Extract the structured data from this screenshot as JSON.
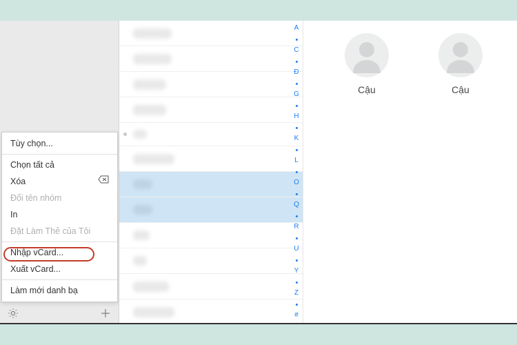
{
  "sidebar": {
    "menu": {
      "preferences": "Tùy chọn...",
      "select_all": "Chọn tất cả",
      "delete": "Xóa",
      "rename_group": "Đổi tên nhóm",
      "print": "In",
      "set_my_card": "Đặt Làm Thẻ của Tôi",
      "import_vcard": "Nhập vCard...",
      "export_vcard": "Xuất vCard...",
      "refresh_contacts": "Làm mới danh bạ"
    }
  },
  "alpha_index": [
    "A",
    "·",
    "C",
    "·",
    "Đ",
    "·",
    "G",
    "·",
    "H",
    "·",
    "K",
    "·",
    "L",
    "·",
    "O",
    "·",
    "Q",
    "·",
    "R",
    "·",
    "U",
    "·",
    "Y",
    "·",
    "Z",
    "·",
    "#"
  ],
  "cards": {
    "card1": "Cậu",
    "card2": "Cậu"
  }
}
